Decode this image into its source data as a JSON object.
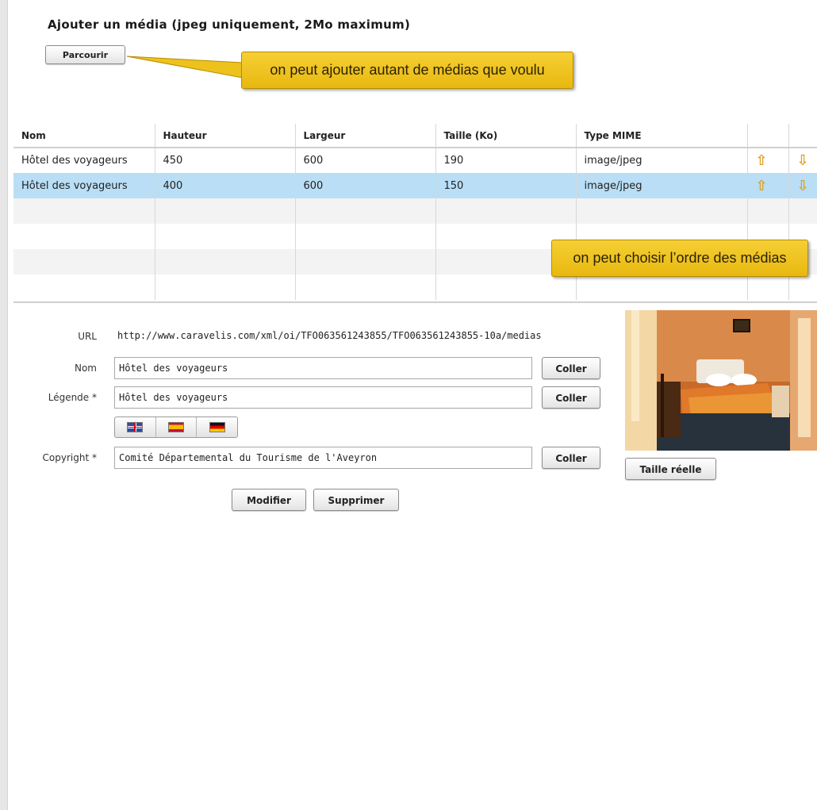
{
  "upload": {
    "title": "Ajouter un média (jpeg uniquement, 2Mo maximum)",
    "browse_label": "Parcourir"
  },
  "annotations": {
    "callout_add": "on peut ajouter autant de médias que voulu",
    "callout_order": "on peut choisir l’ordre des médias"
  },
  "table": {
    "headers": [
      "Nom",
      "Hauteur",
      "Largeur",
      "Taille (Ko)",
      "Type MIME"
    ],
    "rows": [
      [
        "Hôtel des voyageurs",
        "450",
        "600",
        "190",
        "image/jpeg"
      ],
      [
        "Hôtel des voyageurs",
        "400",
        "600",
        "150",
        "image/jpeg"
      ]
    ],
    "selected_row": 1,
    "up_icon": "arrow-up-icon",
    "down_icon": "arrow-down-icon",
    "selected_color": "#b9def5"
  },
  "form": {
    "url_label": "URL",
    "url_value": "http://www.caravelis.com/xml/oi/TFO063561243855/TFO063561243855-10a/medias",
    "nom_label": "Nom",
    "nom_value": "Hôtel des voyageurs",
    "legende_label": "Légende *",
    "legende_value": "Hôtel des voyageurs",
    "copyright_label": "Copyright *",
    "copyright_value": "Comité Départemental du Tourisme de l'Aveyron",
    "paste_label": "Coller",
    "languages": [
      "uk-flag-icon",
      "spain-flag-icon",
      "germany-flag-icon"
    ],
    "modify_label": "Modifier",
    "delete_label": "Supprimer"
  },
  "preview": {
    "real_size_label": "Taille réelle"
  },
  "colors": {
    "callout": "#f0c41e",
    "arrow": "#e0a020"
  }
}
